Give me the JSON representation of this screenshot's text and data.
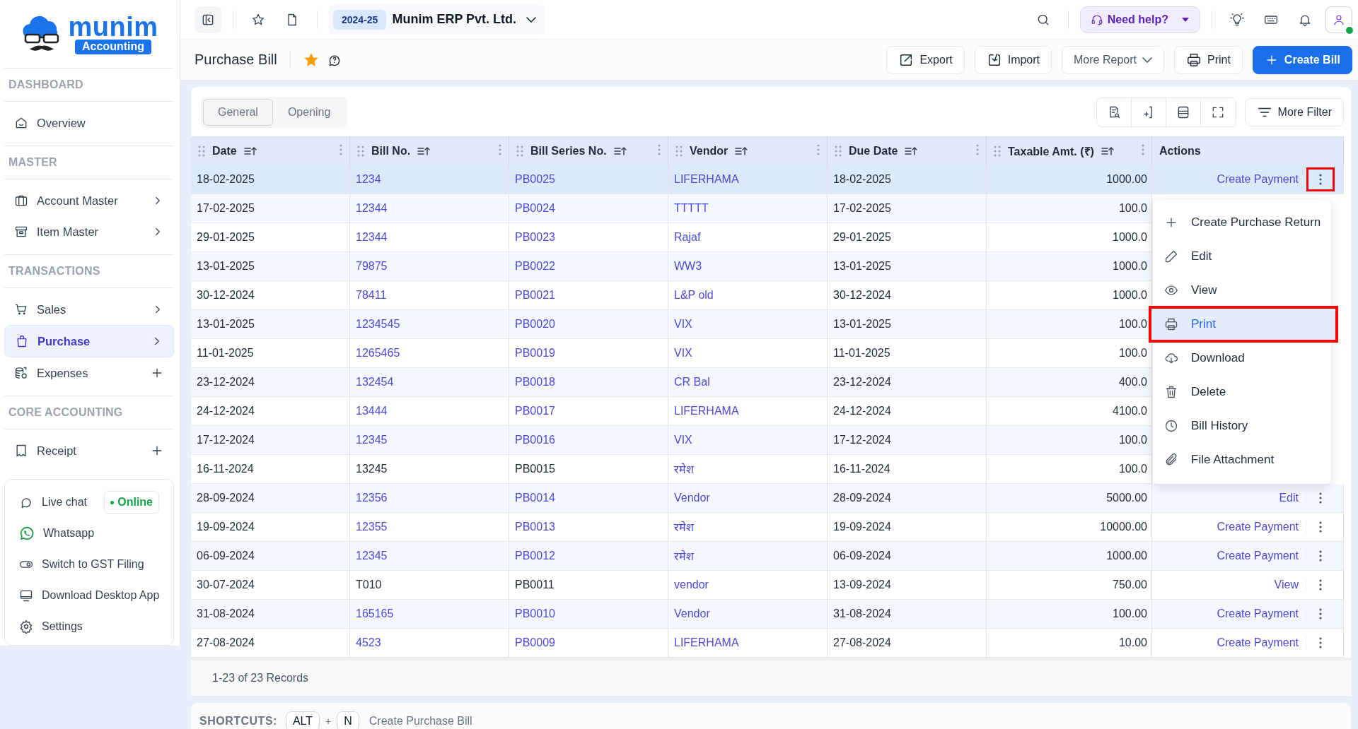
{
  "logo": {
    "name": "munim",
    "tagline": "Accounting"
  },
  "sidebar": {
    "sections": [
      {
        "title": "DASHBOARD",
        "items": [
          {
            "label": "Overview",
            "kind": "link",
            "selected": false
          }
        ]
      },
      {
        "title": "MASTER",
        "items": [
          {
            "label": "Account Master",
            "kind": "group",
            "selected": false
          },
          {
            "label": "Item Master",
            "kind": "group",
            "selected": false
          }
        ]
      },
      {
        "title": "TRANSACTIONS",
        "items": [
          {
            "label": "Sales",
            "kind": "group",
            "selected": false
          },
          {
            "label": "Purchase",
            "kind": "group",
            "selected": true
          },
          {
            "label": "Expenses",
            "kind": "add",
            "selected": false
          }
        ]
      },
      {
        "title": "CORE ACCOUNTING",
        "items": [
          {
            "label": "Receipt",
            "kind": "add",
            "selected": false
          }
        ]
      }
    ]
  },
  "sidebar_footer": [
    {
      "label": "Live chat",
      "badge": "Online"
    },
    {
      "label": "Whatsapp"
    },
    {
      "label": "Switch to GST Filing"
    },
    {
      "label": "Download Desktop App"
    },
    {
      "label": "Settings"
    }
  ],
  "topbar": {
    "year": "2024-25",
    "company": "Munim ERP Pvt. Ltd.",
    "help": "Need help?",
    "online": true
  },
  "page": {
    "title": "Purchase Bill",
    "favorite": true,
    "buttons": [
      {
        "label": "Export",
        "kind": "export"
      },
      {
        "label": "Import",
        "kind": "import"
      },
      {
        "label": "More Report",
        "kind": "dropdown"
      },
      {
        "label": "Print",
        "kind": "print"
      },
      {
        "label": "Create Bill",
        "kind": "primary"
      }
    ]
  },
  "tabs": [
    {
      "label": "General",
      "selected": true
    },
    {
      "label": "Opening",
      "selected": false
    }
  ],
  "toolbar": {
    "filter": "More Filter"
  },
  "table": {
    "columns": [
      {
        "label": "Date",
        "kind": "sortable"
      },
      {
        "label": "Bill No.",
        "kind": "sortable"
      },
      {
        "label": "Bill Series No.",
        "kind": "sortable"
      },
      {
        "label": "Vendor",
        "kind": "sortable"
      },
      {
        "label": "Due Date",
        "kind": "sortable"
      },
      {
        "label": "Taxable Amt. (₹)",
        "kind": "sortable"
      },
      {
        "label": "Actions",
        "kind": "plain"
      }
    ],
    "rows": [
      {
        "date": "18-02-2025",
        "bill_no": "1234",
        "series": "PB0025",
        "vendor": "LIFERHAMA",
        "due_date": "18-02-2025",
        "taxable": "1000.00",
        "action": "Create Payment",
        "linked": true,
        "selected": true,
        "menu_open": true
      },
      {
        "date": "17-02-2025",
        "bill_no": "12344",
        "series": "PB0024",
        "vendor": "TTTTT",
        "due_date": "17-02-2025",
        "taxable": "100.0",
        "linked": true,
        "selected": false,
        "menu_open": false
      },
      {
        "date": "29-01-2025",
        "bill_no": "12344",
        "series": "PB0023",
        "vendor": "Rajaf",
        "due_date": "29-01-2025",
        "taxable": "1000.0",
        "linked": true,
        "selected": false,
        "menu_open": false
      },
      {
        "date": "13-01-2025",
        "bill_no": "79875",
        "series": "PB0022",
        "vendor": "WW3",
        "due_date": "13-01-2025",
        "taxable": "1000.0",
        "linked": true,
        "selected": false,
        "menu_open": false
      },
      {
        "date": "30-12-2024",
        "bill_no": "78411",
        "series": "PB0021",
        "vendor": "L&P old",
        "due_date": "30-12-2024",
        "taxable": "1000.0",
        "linked": true,
        "selected": false,
        "menu_open": false
      },
      {
        "date": "13-01-2025",
        "bill_no": "1234545",
        "series": "PB0020",
        "vendor": "VIX",
        "due_date": "13-01-2025",
        "taxable": "100.0",
        "linked": true,
        "selected": false,
        "menu_open": false
      },
      {
        "date": "11-01-2025",
        "bill_no": "1265465",
        "series": "PB0019",
        "vendor": "VIX",
        "due_date": "11-01-2025",
        "taxable": "100.0",
        "linked": true,
        "selected": false,
        "menu_open": false
      },
      {
        "date": "23-12-2024",
        "bill_no": "132454",
        "series": "PB0018",
        "vendor": "CR Bal",
        "due_date": "23-12-2024",
        "taxable": "400.0",
        "linked": true,
        "selected": false,
        "menu_open": false
      },
      {
        "date": "24-12-2024",
        "bill_no": "13444",
        "series": "PB0017",
        "vendor": "LIFERHAMA",
        "due_date": "24-12-2024",
        "taxable": "4100.0",
        "linked": true,
        "selected": false,
        "menu_open": false
      },
      {
        "date": "17-12-2024",
        "bill_no": "12345",
        "series": "PB0016",
        "vendor": "VIX",
        "due_date": "17-12-2024",
        "taxable": "100.0",
        "linked": true,
        "selected": false,
        "menu_open": false
      },
      {
        "date": "16-11-2024",
        "bill_no": "13245",
        "series": "PB0015",
        "vendor": "रमेश",
        "due_date": "16-11-2024",
        "taxable": "100.0",
        "linked": false,
        "selected": false,
        "menu_open": false
      },
      {
        "date": "28-09-2024",
        "bill_no": "12356",
        "series": "PB0014",
        "vendor": "Vendor",
        "due_date": "28-09-2024",
        "taxable": "5000.00",
        "action": "Edit",
        "linked": true,
        "selected": false,
        "menu_open": false
      },
      {
        "date": "19-09-2024",
        "bill_no": "12355",
        "series": "PB0013",
        "vendor": "रमेश",
        "due_date": "19-09-2024",
        "taxable": "10000.00",
        "action": "Create Payment",
        "linked": true,
        "selected": false,
        "menu_open": false
      },
      {
        "date": "06-09-2024",
        "bill_no": "12345",
        "series": "PB0012",
        "vendor": "रमेश",
        "due_date": "06-09-2024",
        "taxable": "1000.00",
        "action": "Create Payment",
        "linked": true,
        "selected": false,
        "menu_open": false
      },
      {
        "date": "30-07-2024",
        "bill_no": "T010",
        "series": "PB0011",
        "vendor": "vendor",
        "due_date": "13-09-2024",
        "taxable": "750.00",
        "action": "View",
        "linked": false,
        "selected": false,
        "menu_open": false
      },
      {
        "date": "31-08-2024",
        "bill_no": "165165",
        "series": "PB0010",
        "vendor": "Vendor",
        "due_date": "31-08-2024",
        "taxable": "100.00",
        "action": "Create Payment",
        "linked": true,
        "selected": false,
        "menu_open": false
      },
      {
        "date": "27-08-2024",
        "bill_no": "4523",
        "series": "PB0009",
        "vendor": "LIFERHAMA",
        "due_date": "27-08-2024",
        "taxable": "10.00",
        "action": "Create Payment",
        "linked": true,
        "selected": false,
        "menu_open": false
      }
    ]
  },
  "row_menu": [
    {
      "label": "Create Purchase Return",
      "kind": "add",
      "selected": false
    },
    {
      "label": "Edit",
      "kind": "edit",
      "selected": false
    },
    {
      "label": "View",
      "kind": "view",
      "selected": false
    },
    {
      "label": "Print",
      "kind": "print",
      "selected": true
    },
    {
      "label": "Download",
      "kind": "download",
      "selected": false
    },
    {
      "label": "Delete",
      "kind": "delete",
      "selected": false
    },
    {
      "label": "Bill History",
      "kind": "history",
      "selected": false
    },
    {
      "label": "File Attachment",
      "kind": "attach",
      "selected": false
    }
  ],
  "records": "1-23 of 23 Records",
  "shortcuts": {
    "title": "SHORTCUTS:",
    "keys": [
      "ALT",
      "N"
    ],
    "joiner": "+",
    "action": "Create Purchase Bill"
  }
}
